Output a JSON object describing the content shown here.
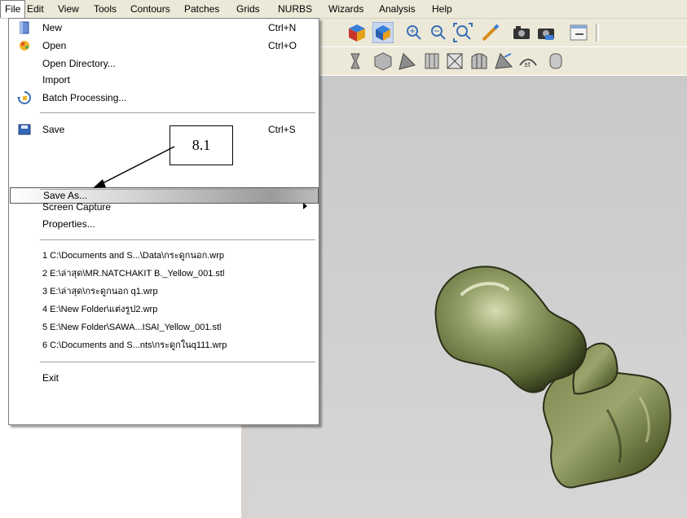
{
  "menubar": {
    "items": [
      "File",
      "Edit",
      "View",
      "Tools",
      "Contours",
      "Patches",
      "Grids",
      "NURBS",
      "Wizards",
      "Analysis",
      "Help"
    ]
  },
  "file_menu": {
    "new": {
      "label": "New",
      "shortcut": "Ctrl+N"
    },
    "open": {
      "label": "Open",
      "shortcut": "Ctrl+O"
    },
    "open_directory": {
      "label": "Open Directory..."
    },
    "import": {
      "label": "Import"
    },
    "batch_processing": {
      "label": "Batch Processing..."
    },
    "save": {
      "label": "Save",
      "shortcut": "Ctrl+S"
    },
    "save_as": {
      "label": "Save As..."
    },
    "screen_capture": {
      "label": "Screen Capture"
    },
    "properties": {
      "label": "Properties..."
    },
    "recent": [
      "1 C:\\Documents and S...\\Data\\กระดูกนอก.wrp",
      "2 E:\\ล่าสุด\\MR.NATCHAKIT B._Yellow_001.stl",
      "3 E:\\ล่าสุด\\กระดูกนอก q1.wrp",
      "4 E:\\New Folder\\แต่งรูป2.wrp",
      "5 E:\\New Folder\\SAWA...ISAI_Yellow_001.stl",
      "6 C:\\Documents and S...nts\\กระดูกในq111.wrp"
    ],
    "exit": {
      "label": "Exit"
    }
  },
  "annotation": {
    "label": "8.1"
  },
  "icons": {
    "new": "new-document-icon",
    "open": "open-folder-icon",
    "batch": "batch-processing-icon",
    "save": "save-disk-icon"
  },
  "colors": {
    "menu_highlight": "#9a9a9a",
    "model": "#7d8a55",
    "viewport_bg": "#cfcfcf"
  }
}
